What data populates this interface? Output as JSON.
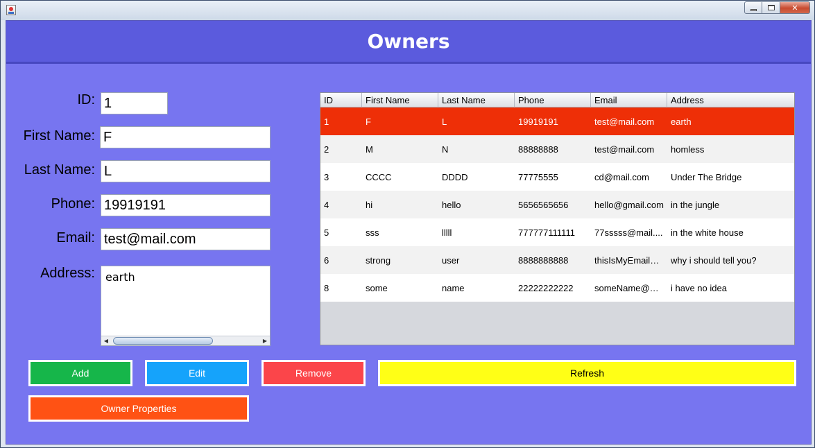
{
  "window": {
    "title": ""
  },
  "header": {
    "title": "Owners"
  },
  "form": {
    "id_label": "ID:",
    "id_value": "1",
    "first_label": "First Name:",
    "first_value": "F",
    "last_label": "Last Name:",
    "last_value": "L",
    "phone_label": "Phone:",
    "phone_value": "19919191",
    "email_label": "Email:",
    "email_value": "test@mail.com",
    "address_label": "Address:",
    "address_value": "earth"
  },
  "table": {
    "columns": [
      "ID",
      "First Name",
      "Last Name",
      "Phone",
      "Email",
      "Address"
    ],
    "rows": [
      [
        "1",
        "F",
        "L",
        "19919191",
        "test@mail.com",
        "earth"
      ],
      [
        "2",
        "M",
        "N",
        "88888888",
        "test@mail.com",
        "homless"
      ],
      [
        "3",
        "CCCC",
        "DDDD",
        "77775555",
        "cd@mail.com",
        "Under The Bridge"
      ],
      [
        "4",
        "hi",
        "hello",
        "5656565656",
        "hello@gmail.com",
        "in the jungle"
      ],
      [
        "5",
        "sss",
        "lllll",
        "777777111111",
        "77sssss@mail....",
        "in the white house"
      ],
      [
        "6",
        "strong",
        "user",
        "8888888888",
        "thisIsMyEmail@...",
        "why i should tell you?"
      ],
      [
        "8",
        "some",
        "name",
        "22222222222",
        "someName@m...",
        "i have no idea"
      ]
    ],
    "selected_row": 0
  },
  "buttons": {
    "add": "Add",
    "edit": "Edit",
    "remove": "Remove",
    "refresh": "Refresh",
    "owner_properties": "Owner Properties"
  },
  "colors": {
    "background": "#7775f0",
    "header": "#5b5bdd",
    "selected_row": "#ee2f07",
    "add": "#16b64a",
    "edit": "#15a3fb",
    "remove": "#fb454a",
    "refresh": "#ffff16",
    "owner_properties": "#ff5214"
  }
}
